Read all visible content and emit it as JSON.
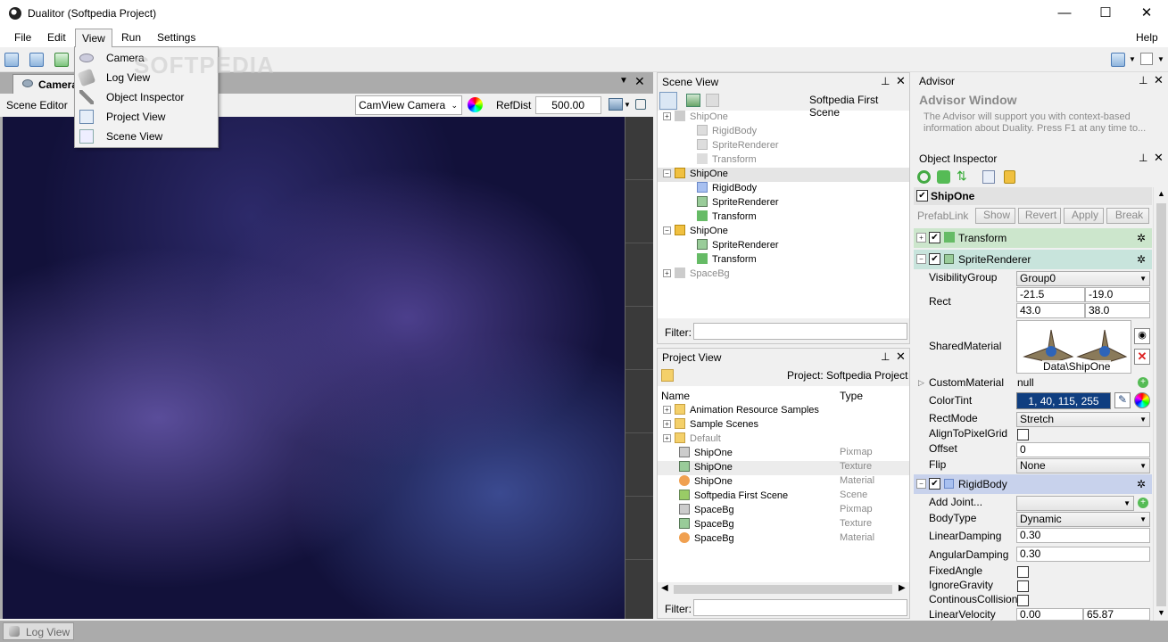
{
  "window": {
    "title": "Dualitor (Softpedia Project)",
    "min": "—",
    "max": "☐",
    "close": "✕"
  },
  "menu": {
    "file": "File",
    "edit": "Edit",
    "view": "View",
    "run": "Run",
    "settings": "Settings",
    "help": "Help"
  },
  "view_menu": {
    "items": [
      "Camera",
      "Log View",
      "Object Inspector",
      "Project View",
      "Scene View"
    ]
  },
  "watermark": "SOFTPEDIA",
  "camera_panel": {
    "tab": "Camera",
    "mode_label": "Scene Editor",
    "camera_select": "CamView Camera",
    "refdist_label": "RefDist",
    "refdist_value": "500.00"
  },
  "scene_view": {
    "title": "Scene View",
    "scene_name": "Softpedia First Scene",
    "filter_label": "Filter:",
    "rows": [
      {
        "label": "ShipOne",
        "level": 0,
        "exp": "+",
        "gray": true
      },
      {
        "label": "RigidBody",
        "level": 1,
        "gray": true
      },
      {
        "label": "SpriteRenderer",
        "level": 1,
        "gray": true
      },
      {
        "label": "Transform",
        "level": 1,
        "gray": true
      },
      {
        "label": "ShipOne",
        "level": 0,
        "exp": "−",
        "gray": false
      },
      {
        "label": "RigidBody",
        "level": 1,
        "gray": false
      },
      {
        "label": "SpriteRenderer",
        "level": 1,
        "gray": false
      },
      {
        "label": "Transform",
        "level": 1,
        "gray": false
      },
      {
        "label": "ShipOne",
        "level": 0,
        "exp": "−",
        "gray": false
      },
      {
        "label": "SpriteRenderer",
        "level": 1,
        "gray": false
      },
      {
        "label": "Transform",
        "level": 1,
        "gray": false
      },
      {
        "label": "SpaceBg",
        "level": 0,
        "exp": "+",
        "gray": true
      }
    ]
  },
  "project_view": {
    "title": "Project View",
    "project_name": "Project: Softpedia Project",
    "col_name": "Name",
    "col_type": "Type",
    "filter_label": "Filter:",
    "rows": [
      {
        "name": "Animation Resource Samples",
        "type": "",
        "folder": true
      },
      {
        "name": "Sample Scenes",
        "type": "",
        "folder": true
      },
      {
        "name": "Default",
        "type": "",
        "folder": true,
        "gray": true
      },
      {
        "name": "ShipOne",
        "type": "Pixmap"
      },
      {
        "name": "ShipOne",
        "type": "Texture"
      },
      {
        "name": "ShipOne",
        "type": "Material"
      },
      {
        "name": "Softpedia First Scene",
        "type": "Scene"
      },
      {
        "name": "SpaceBg",
        "type": "Pixmap"
      },
      {
        "name": "SpaceBg",
        "type": "Texture"
      },
      {
        "name": "SpaceBg",
        "type": "Material"
      }
    ]
  },
  "advisor": {
    "title": "Advisor",
    "heading": "Advisor Window",
    "text": "The Advisor will support you with context-based information about Duality. Press F1 at any time to..."
  },
  "inspector": {
    "title": "Object Inspector",
    "object_name": "ShipOne",
    "buttons": [
      "PrefabLink",
      "Show",
      "Revert",
      "Apply",
      "Break"
    ],
    "sections": {
      "transform": "Transform",
      "sprite": "SpriteRenderer",
      "rigid": "RigidBody"
    },
    "props": {
      "visibility_group": {
        "label": "VisibilityGroup",
        "value": "Group0"
      },
      "rect": {
        "label": "Rect",
        "x": "-21.5",
        "y": "-19.0",
        "w": "43.0",
        "h": "38.0"
      },
      "shared_material": {
        "label": "SharedMaterial",
        "value": "Data\\ShipOne"
      },
      "custom_material": {
        "label": "CustomMaterial",
        "value": "null"
      },
      "color_tint": {
        "label": "ColorTint",
        "value": "1, 40, 115, 255"
      },
      "rect_mode": {
        "label": "RectMode",
        "value": "Stretch"
      },
      "align": {
        "label": "AlignToPixelGrid"
      },
      "offset": {
        "label": "Offset",
        "value": "0"
      },
      "flip": {
        "label": "Flip",
        "value": "None"
      },
      "add_joint": {
        "label": "Add Joint..."
      },
      "body_type": {
        "label": "BodyType",
        "value": "Dynamic"
      },
      "linear_damping": {
        "label": "LinearDamping",
        "value": "0.30"
      },
      "angular_damping": {
        "label": "AngularDamping",
        "value": "0.30"
      },
      "fixed_angle": {
        "label": "FixedAngle"
      },
      "ignore_gravity": {
        "label": "IgnoreGravity"
      },
      "continous_collision": {
        "label": "ContinousCollision"
      },
      "linear_velocity": {
        "label": "LinearVelocity",
        "x": "0.00",
        "y": "65.87"
      }
    }
  },
  "statusbar": {
    "log_tab": "Log View"
  },
  "colors": {
    "accent_tint": "#0f3e80",
    "transform_bg": "#cce6cc",
    "sprite_bg": "#c8e4dc",
    "rigid_bg": "#c8d2ec"
  }
}
